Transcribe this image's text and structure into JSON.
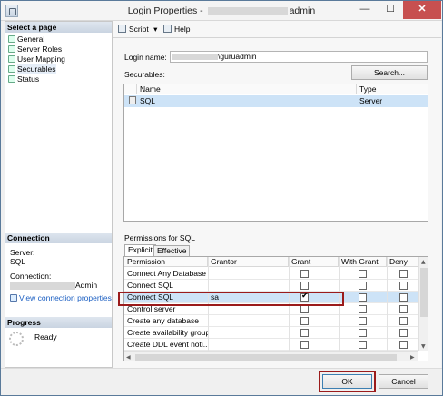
{
  "window": {
    "title_prefix": "Login Properties -",
    "title_suffix": "admin",
    "minimize": "—",
    "maximize": "☐",
    "close": "✕"
  },
  "left": {
    "select_page_header": "Select a page",
    "pages": [
      {
        "label": "General",
        "selected": false
      },
      {
        "label": "Server Roles",
        "selected": false
      },
      {
        "label": "User Mapping",
        "selected": false
      },
      {
        "label": "Securables",
        "selected": true
      },
      {
        "label": "Status",
        "selected": false
      }
    ],
    "connection_header": "Connection",
    "server_label": "Server:",
    "server_value": "SQL",
    "connection_label": "Connection:",
    "connection_value_suffix": "Admin",
    "view_connection_link": "View connection properties",
    "progress_header": "Progress",
    "progress_status": "Ready"
  },
  "toolbar": {
    "script_label": "Script",
    "script_dropdown": "▾",
    "help_label": "Help"
  },
  "main": {
    "login_name_label": "Login name:",
    "login_name_value": "\\guruadmin",
    "securables_label": "Securables:",
    "search_button": "Search...",
    "securables_columns": [
      "Name",
      "Type"
    ],
    "securables_rows": [
      {
        "name": "SQL",
        "type": "Server"
      }
    ],
    "permissions_for_label": "Permissions for SQL",
    "tabs": [
      "Explicit",
      "Effective"
    ],
    "permission_columns": [
      "Permission",
      "Grantor",
      "Grant",
      "With Grant",
      "Deny"
    ],
    "permission_rows": [
      {
        "permission": "Connect Any Database",
        "grantor": "",
        "grant": false,
        "with_grant": false,
        "deny": false,
        "selected": false
      },
      {
        "permission": "Connect SQL",
        "grantor": "",
        "grant": false,
        "with_grant": false,
        "deny": false,
        "selected": false
      },
      {
        "permission": "Connect SQL",
        "grantor": "sa",
        "grant": true,
        "with_grant": false,
        "deny": false,
        "selected": true
      },
      {
        "permission": "Control server",
        "grantor": "",
        "grant": false,
        "with_grant": false,
        "deny": false,
        "selected": false
      },
      {
        "permission": "Create any database",
        "grantor": "",
        "grant": false,
        "with_grant": false,
        "deny": false,
        "selected": false
      },
      {
        "permission": "Create availability group",
        "grantor": "",
        "grant": false,
        "with_grant": false,
        "deny": false,
        "selected": false
      },
      {
        "permission": "Create DDL event noti...",
        "grantor": "",
        "grant": false,
        "with_grant": false,
        "deny": false,
        "selected": false
      }
    ]
  },
  "footer": {
    "ok_label": "OK",
    "cancel_label": "Cancel"
  },
  "colors": {
    "highlight_box": "#9b1b1b",
    "selection": "#cde3f7",
    "link": "#1a5ec2",
    "close_button": "#c75050"
  }
}
